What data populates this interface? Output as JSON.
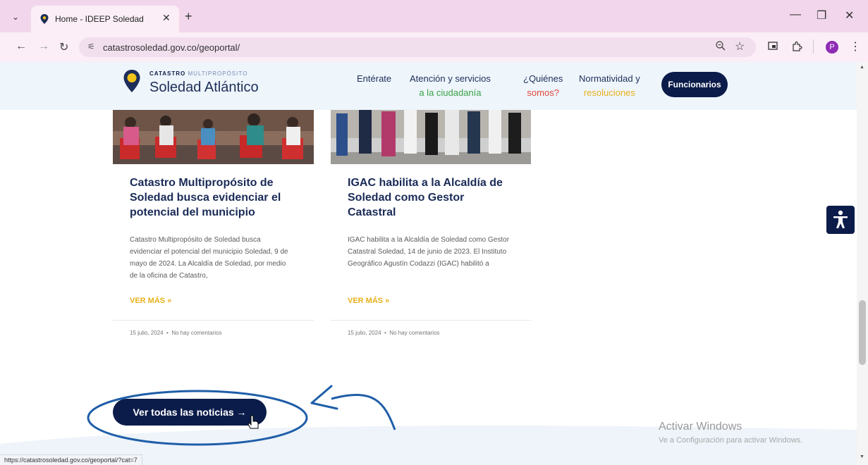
{
  "browser": {
    "tab_title": "Home - IDEEP Soledad",
    "url": "catastrosoledad.gov.co/geoportal/",
    "status_url": "https://catastrosoledad.gov.co/geoportal/?cat=7",
    "profile_initial": "P"
  },
  "header": {
    "logo_top_bold": "CATASTRO",
    "logo_top_light": "MULTIPROPÓSITO",
    "logo_main": "Soledad Atlántico",
    "nav": [
      {
        "line1": "Entérate",
        "line2": ""
      },
      {
        "line1": "Atención y servicios",
        "line2": "a la ciudadanía"
      },
      {
        "line1": "¿Quiénes",
        "line2": "somos?"
      },
      {
        "line1": "Normatividad y",
        "line2": "resoluciones"
      }
    ],
    "cta": "Funcionarios"
  },
  "cards": [
    {
      "title": "Catastro Multipropósito de Soledad busca evidenciar el potencial del municipio",
      "excerpt": "Catastro Multipropósito de Soledad busca evidenciar el potencial del municipio Soledad, 9 de mayo de 2024. La Alcaldía de Soledad, por medio de la oficina de Catastro,",
      "more": "VER MÁS »",
      "date": "15 julio, 2024",
      "comments": "No hay comentarios"
    },
    {
      "title": "IGAC habilita a la Alcaldía de Soledad como Gestor Catastral",
      "excerpt": "IGAC habilita a la Alcaldía de Soledad como Gestor Catastral Soledad, 14 de junio de 2023. El Instituto Geográfico Agustín Codazzi (IGAC) habilitó a",
      "more": "VER MÁS »",
      "date": "15 julio, 2024",
      "comments": "No hay comentarios"
    }
  ],
  "see_all": "Ver todas las noticias →",
  "windows": {
    "line1": "Activar Windows",
    "line2": "Ve a Configuración para activar Windows."
  },
  "colors": {
    "navy": "#0b1c4a",
    "yellow": "#e8b11b",
    "green": "#3aa348",
    "red": "#e2453c",
    "annotation": "#1f5ea8"
  }
}
